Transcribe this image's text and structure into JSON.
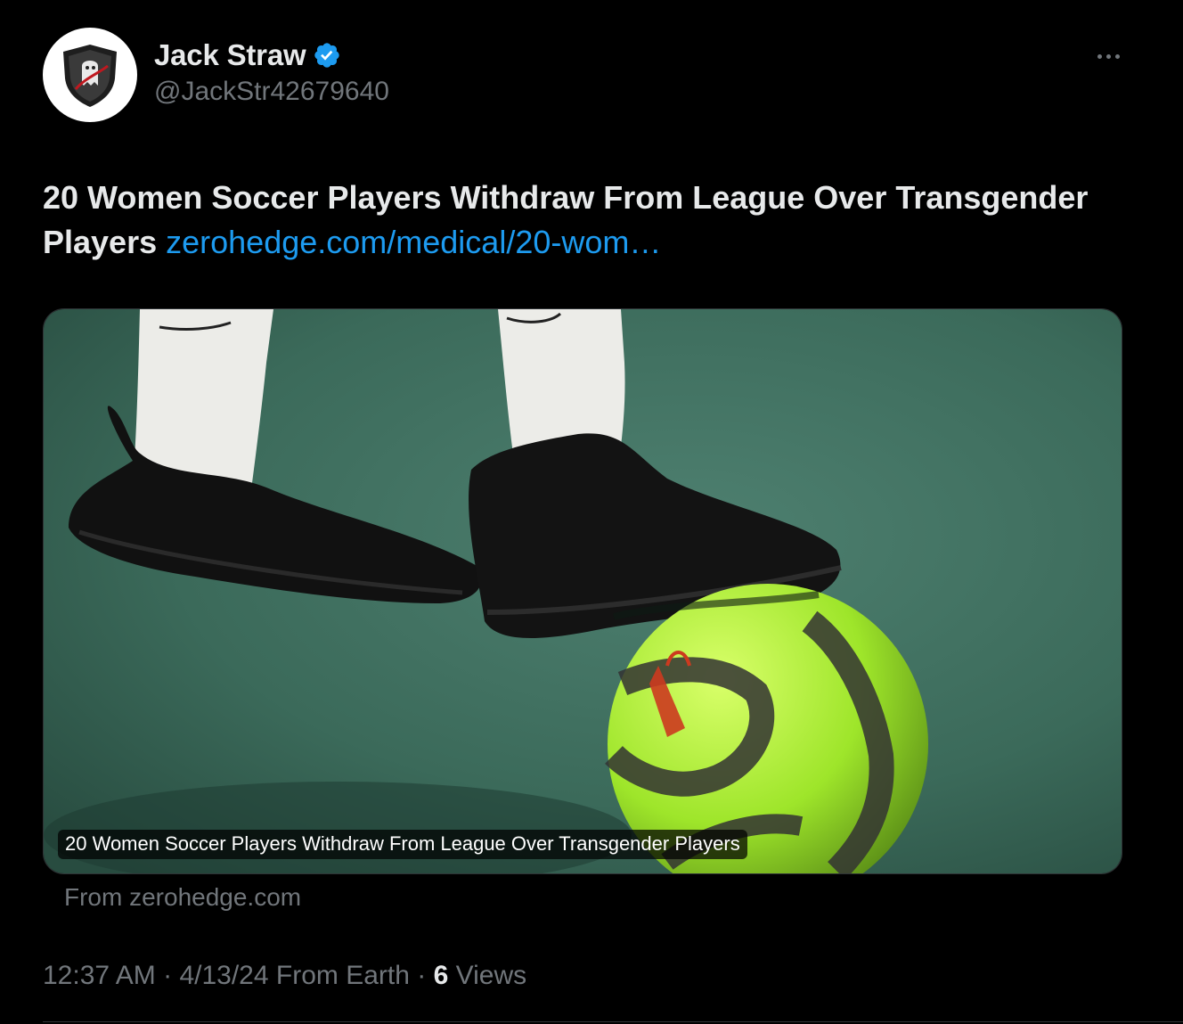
{
  "author": {
    "display_name": "Jack Straw",
    "handle": "@JackStr42679640",
    "verified": true,
    "avatar_icon": "ghost-shield-avatar"
  },
  "tweet": {
    "text": "20 Women Soccer Players Withdraw From League Over Transgender Players",
    "link_text": "zerohedge.com/medical/20-wom…"
  },
  "card": {
    "image_caption": "20 Women Soccer Players Withdraw From League Over Transgender Players",
    "source": "From zerohedge.com"
  },
  "meta": {
    "time": "12:37 AM",
    "date": "4/13/24",
    "location": "From Earth",
    "separator": "·",
    "views_count": "6",
    "views_label": "Views"
  },
  "colors": {
    "background": "#000000",
    "text": "#e7e9ea",
    "secondary": "#71767b",
    "link": "#1d9bf0",
    "verified": "#1d9bf0"
  }
}
